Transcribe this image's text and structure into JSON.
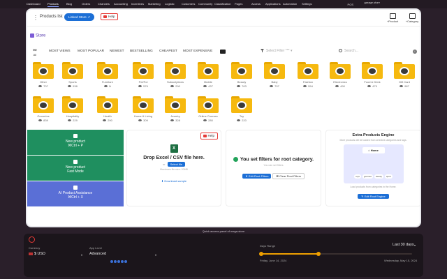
{
  "nav": {
    "items": [
      "Dashboard",
      "Products",
      "Blog",
      "Orders",
      "Channels",
      "Accounting",
      "Incentives",
      "Marketing",
      "Logistic",
      "Customers",
      "Community",
      "Classification",
      "Pages",
      "Access",
      "Applications",
      "Automation",
      "Settings"
    ],
    "active": "Products",
    "user": "garage.store",
    "pos": "POS"
  },
  "toolbar": {
    "title": "Products list",
    "linked_label": "Linked Store",
    "help_label": "Help",
    "actions": [
      {
        "label": "+Product",
        "icon": "product-icon"
      },
      {
        "label": "+Category",
        "icon": "folder-icon"
      }
    ]
  },
  "store": {
    "label": "Store"
  },
  "filters": {
    "all_label": "All",
    "tabs": [
      "MOST VIEWS",
      "MOST POPULAR",
      "NEWEST",
      "BESTSELLING",
      "CHEAPEST",
      "MOST EXPENSIVE"
    ],
    "select_placeholder": "Select Filter ***",
    "search_placeholder": "Search..."
  },
  "categories": [
    {
      "name": "Other",
      "count": "707"
    },
    {
      "name": "Sports",
      "count": "938"
    },
    {
      "name": "Furniture",
      "count": "N"
    },
    {
      "name": "Pet/Fol",
      "count": "576"
    },
    {
      "name": "Subscriptions",
      "count": "290"
    },
    {
      "name": "Mobile",
      "count": "437"
    },
    {
      "name": "Beauty",
      "count": "763"
    },
    {
      "name": "Baby",
      "count": "707"
    },
    {
      "name": "Fashion",
      "count": "554"
    },
    {
      "name": "Electronics",
      "count": "490"
    },
    {
      "name": "Food & Drink",
      "count": "479"
    },
    {
      "name": "Gift Card",
      "count": "987"
    },
    {
      "name": "Groceries",
      "count": "839"
    },
    {
      "name": "Hospitality",
      "count": "229"
    },
    {
      "name": "Health",
      "count": "290"
    },
    {
      "name": "Home & Living",
      "count": "309"
    },
    {
      "name": "Jewelry",
      "count": "328"
    },
    {
      "name": "Online Courses",
      "count": "280"
    },
    {
      "name": "Toy",
      "count": "220"
    }
  ],
  "actions": {
    "new_product": {
      "line1": "New product",
      "line2": "⌘Ctrl + P"
    },
    "fast_mode": {
      "line1": "New product",
      "line2": "Fast Mode"
    },
    "ai": {
      "line1": "AI Product Assistance",
      "line2": "⌘Ctrl + X"
    }
  },
  "excel_card": {
    "help_label": "Help",
    "title": "Drop Excel / CSV file here.",
    "or": "or",
    "select_file": "Select file",
    "max": "Maximum file size: 20MB",
    "download": "Download sample"
  },
  "filter_card": {
    "title": "You set filters for root category.",
    "sub": "You can set filters",
    "edit": "Edit Root Filters",
    "clear": "Clear Root Filters"
  },
  "engine_card": {
    "title": "Extra Products Engine",
    "desc": "More products will be loaded from selected categories and tags.",
    "home": "Home",
    "chips": [
      "toys",
      "gourmet",
      "beauty",
      "sport"
    ],
    "loaded": "Load products from categories in the Home.",
    "edit": "Edit Root Engine"
  },
  "bottom": {
    "quick_label": "Quick access panel of mega-store",
    "currency_label": "Currency",
    "currency_value": "USD",
    "currency_symbol": "$",
    "app_level_label": "App Level",
    "app_level_value": "Advanced",
    "days_label": "Days Range",
    "days_value": "Last 30 days",
    "date_start": "Friday, June 14, 2024",
    "date_end": "Wednesday, May 15, 2024",
    "range_start": 0.0,
    "range_end": 0.38
  },
  "colors": {
    "accent": "#1c6fd6",
    "green": "#1f8f5f",
    "ai": "#5a6fd6",
    "folder": "#f6b90f",
    "slider": "#f0a000",
    "danger": "#e53935"
  }
}
